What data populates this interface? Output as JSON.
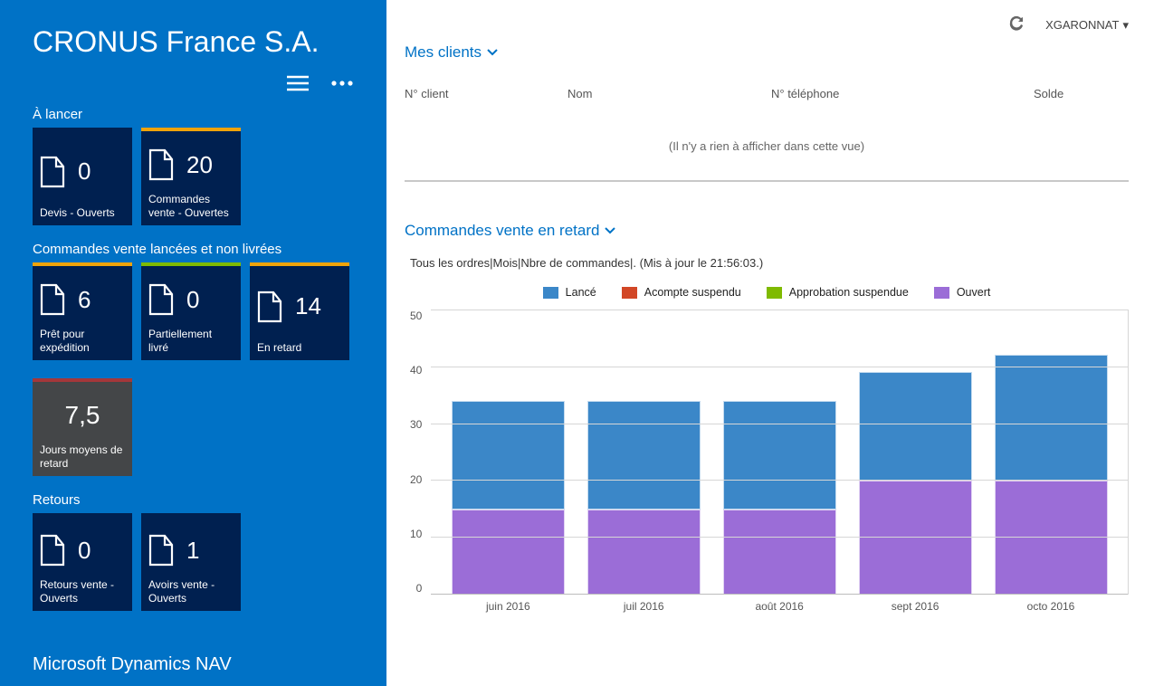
{
  "sidebar": {
    "company": "CRONUS France S.A.",
    "sections": {
      "a_lancer": {
        "title": "À lancer",
        "tiles": [
          {
            "value": "0",
            "label": "Devis - Ouverts"
          },
          {
            "value": "20",
            "label": "Commandes vente - Ouvertes"
          }
        ]
      },
      "lancees": {
        "title": "Commandes vente lancées et non livrées",
        "tiles": [
          {
            "value": "6",
            "label": "Prêt pour expédition"
          },
          {
            "value": "0",
            "label": "Partiellement livré"
          },
          {
            "value": "14",
            "label": "En retard"
          },
          {
            "value": "7,5",
            "label": "Jours moyens de retard"
          }
        ]
      },
      "retours": {
        "title": "Retours",
        "tiles": [
          {
            "value": "0",
            "label": "Retours vente - Ouverts"
          },
          {
            "value": "1",
            "label": "Avoirs vente - Ouverts"
          }
        ]
      }
    },
    "footer": "Microsoft Dynamics NAV"
  },
  "topbar": {
    "user": "XGARONNAT"
  },
  "clients": {
    "heading": "Mes clients",
    "columns": {
      "client": "N° client",
      "nom": "Nom",
      "tel": "N° téléphone",
      "solde": "Solde"
    },
    "empty": "(Il n'y a rien à afficher dans cette vue)"
  },
  "orders_chart": {
    "heading": "Commandes vente en retard",
    "meta": "Tous les ordres|Mois|Nbre de commandes|. (Mis à jour le 21:56:03.)"
  },
  "colors": {
    "lance": "#3B87C8",
    "acompte": "#D24726",
    "approbation": "#7FBA00",
    "ouvert": "#9B6DD7"
  },
  "chart_data": {
    "type": "bar",
    "stacked": true,
    "title": "Commandes vente en retard",
    "xlabel": "",
    "ylabel": "Nbre de commandes",
    "ylim": [
      0,
      50
    ],
    "yticks": [
      0,
      10,
      20,
      30,
      40,
      50
    ],
    "categories": [
      "juin 2016",
      "juil 2016",
      "août 2016",
      "sept 2016",
      "octo 2016"
    ],
    "series": [
      {
        "name": "Lancé",
        "color": "#3B87C8",
        "values": [
          19,
          19,
          19,
          19,
          22
        ]
      },
      {
        "name": "Acompte suspendu",
        "color": "#D24726",
        "values": [
          0,
          0,
          0,
          0,
          0
        ]
      },
      {
        "name": "Approbation suspendue",
        "color": "#7FBA00",
        "values": [
          0,
          0,
          0,
          0,
          0
        ]
      },
      {
        "name": "Ouvert",
        "color": "#9B6DD7",
        "values": [
          15,
          15,
          15,
          20,
          20
        ]
      }
    ]
  }
}
